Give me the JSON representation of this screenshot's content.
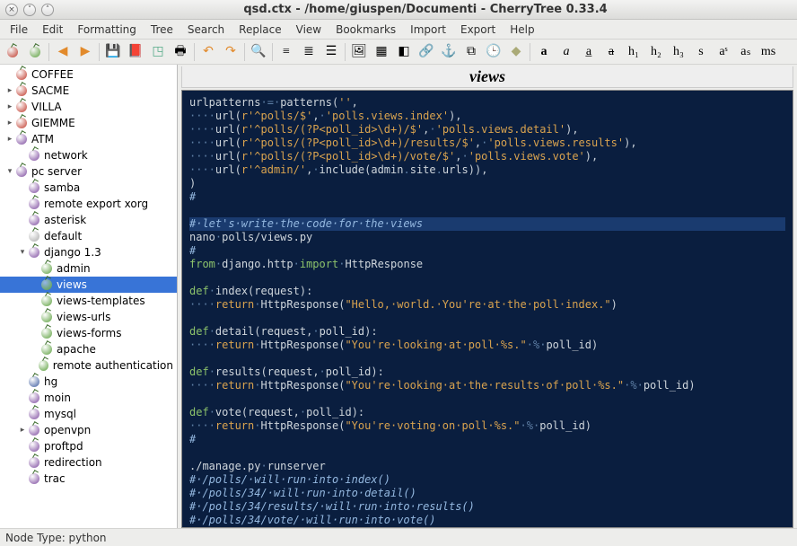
{
  "window": {
    "title": "qsd.ctx - /home/giuspen/Documenti - CherryTree 0.33.4"
  },
  "menubar": [
    "File",
    "Edit",
    "Formatting",
    "Tree",
    "Search",
    "Replace",
    "View",
    "Bookmarks",
    "Import",
    "Export",
    "Help"
  ],
  "toolbar_groups": [
    [
      {
        "name": "cherry-red-icon",
        "glyph": "",
        "cls": "cherry c-red"
      },
      {
        "name": "cherry-green-icon",
        "glyph": "",
        "cls": "cherry c-green"
      }
    ],
    [
      {
        "name": "back-icon",
        "glyph": "◀",
        "color": "#e28a2b"
      },
      {
        "name": "forward-icon",
        "glyph": "▶",
        "color": "#e28a2b"
      }
    ],
    [
      {
        "name": "save-icon",
        "glyph": "💾"
      },
      {
        "name": "export-pdf-icon",
        "glyph": "📕"
      },
      {
        "name": "find-replace-icon",
        "glyph": "◳",
        "color": "#5a8"
      },
      {
        "name": "print-icon",
        "glyph": "🖶"
      }
    ],
    [
      {
        "name": "undo-icon",
        "glyph": "↶",
        "color": "#e28a2b"
      },
      {
        "name": "redo-icon",
        "glyph": "↷",
        "color": "#e28a2b"
      }
    ],
    [
      {
        "name": "search-icon",
        "glyph": "🔍"
      }
    ],
    [
      {
        "name": "bullet-list-icon",
        "glyph": "≡"
      },
      {
        "name": "numbered-list-icon",
        "glyph": "≣"
      },
      {
        "name": "todo-list-icon",
        "glyph": "☰"
      }
    ],
    [
      {
        "name": "insert-image-icon",
        "glyph": "🖼"
      },
      {
        "name": "insert-table-icon",
        "glyph": "▦"
      },
      {
        "name": "insert-codebox-icon",
        "glyph": "◧"
      },
      {
        "name": "insert-link-icon",
        "glyph": "🔗"
      },
      {
        "name": "insert-anchor-icon",
        "glyph": "⚓"
      },
      {
        "name": "insert-toc-icon",
        "glyph": "⧉"
      },
      {
        "name": "insert-timestamp-icon",
        "glyph": "🕒"
      },
      {
        "name": "insert-special-icon",
        "glyph": "◆",
        "color": "#aa7"
      }
    ],
    [
      {
        "name": "format-bold-icon",
        "glyph": "a",
        "bold": true
      },
      {
        "name": "format-italic-icon",
        "glyph": "a",
        "italic": true
      },
      {
        "name": "format-underline-icon",
        "glyph": "a̲"
      },
      {
        "name": "format-strike-icon",
        "glyph": "a",
        "strike": true
      },
      {
        "name": "format-h1-icon",
        "glyph": "h₁"
      },
      {
        "name": "format-h2-icon",
        "glyph": "h₂"
      },
      {
        "name": "format-h3-icon",
        "glyph": "h₃"
      },
      {
        "name": "format-small-icon",
        "glyph": "s"
      },
      {
        "name": "format-sup-icon",
        "glyph": "aˢ"
      },
      {
        "name": "format-sub-icon",
        "glyph": "aₛ"
      },
      {
        "name": "format-mono-icon",
        "glyph": "ms"
      }
    ]
  ],
  "tree": [
    {
      "label": "COFFEE",
      "depth": 0,
      "exp": "",
      "color": "c-red"
    },
    {
      "label": "SACME",
      "depth": 0,
      "exp": "▸",
      "color": "c-red"
    },
    {
      "label": "VILLA",
      "depth": 0,
      "exp": "▸",
      "color": "c-red"
    },
    {
      "label": "GIEMME",
      "depth": 0,
      "exp": "▸",
      "color": "c-red"
    },
    {
      "label": "ATM",
      "depth": 0,
      "exp": "▸",
      "color": "c-purple"
    },
    {
      "label": "network",
      "depth": 1,
      "exp": "",
      "color": "c-purple"
    },
    {
      "label": "pc server",
      "depth": 0,
      "exp": "▾",
      "color": "c-purple"
    },
    {
      "label": "samba",
      "depth": 1,
      "exp": "",
      "color": "c-purple"
    },
    {
      "label": "remote export xorg",
      "depth": 1,
      "exp": "",
      "color": "c-purple"
    },
    {
      "label": "asterisk",
      "depth": 1,
      "exp": "",
      "color": "c-purple"
    },
    {
      "label": "default",
      "depth": 1,
      "exp": "",
      "color": "c-gray"
    },
    {
      "label": "django 1.3",
      "depth": 1,
      "exp": "▾",
      "color": "c-purple"
    },
    {
      "label": "admin",
      "depth": 2,
      "exp": "",
      "color": "c-green"
    },
    {
      "label": "views",
      "depth": 2,
      "exp": "",
      "color": "c-green",
      "selected": true
    },
    {
      "label": "views-templates",
      "depth": 2,
      "exp": "",
      "color": "c-green"
    },
    {
      "label": "views-urls",
      "depth": 2,
      "exp": "",
      "color": "c-green"
    },
    {
      "label": "views-forms",
      "depth": 2,
      "exp": "",
      "color": "c-green"
    },
    {
      "label": "apache",
      "depth": 2,
      "exp": "",
      "color": "c-green"
    },
    {
      "label": "remote authentication",
      "depth": 2,
      "exp": "",
      "color": "c-green"
    },
    {
      "label": "hg",
      "depth": 1,
      "exp": "",
      "color": "c-blue"
    },
    {
      "label": "moin",
      "depth": 1,
      "exp": "",
      "color": "c-purple"
    },
    {
      "label": "mysql",
      "depth": 1,
      "exp": "",
      "color": "c-purple"
    },
    {
      "label": "openvpn",
      "depth": 1,
      "exp": "▸",
      "color": "c-purple"
    },
    {
      "label": "proftpd",
      "depth": 1,
      "exp": "",
      "color": "c-purple"
    },
    {
      "label": "redirection",
      "depth": 1,
      "exp": "",
      "color": "c-purple"
    },
    {
      "label": "trac",
      "depth": 1,
      "exp": "",
      "color": "c-purple"
    }
  ],
  "doc_title": "views",
  "code_lines": [
    [
      {
        "t": "urlpatterns",
        "c": "id"
      },
      {
        "t": "·",
        "c": "samp"
      },
      {
        "t": "=",
        "c": "op"
      },
      {
        "t": "·",
        "c": "samp"
      },
      {
        "t": "patterns",
        "c": "id"
      },
      {
        "t": "(",
        "c": "br"
      },
      {
        "t": "''",
        "c": "str"
      },
      {
        "t": ",",
        "c": "br"
      }
    ],
    [
      {
        "t": "····",
        "c": "samp"
      },
      {
        "t": "url",
        "c": "id"
      },
      {
        "t": "(",
        "c": "br"
      },
      {
        "t": "r'^polls/$'",
        "c": "str"
      },
      {
        "t": ",",
        "c": "br"
      },
      {
        "t": "·",
        "c": "samp"
      },
      {
        "t": "'polls.views.index'",
        "c": "str"
      },
      {
        "t": ")",
        "c": "br"
      },
      {
        "t": ",",
        "c": "br"
      }
    ],
    [
      {
        "t": "····",
        "c": "samp"
      },
      {
        "t": "url",
        "c": "id"
      },
      {
        "t": "(",
        "c": "br"
      },
      {
        "t": "r'^polls/(?P<poll_id>\\d+)/$'",
        "c": "str"
      },
      {
        "t": ",",
        "c": "br"
      },
      {
        "t": "·",
        "c": "samp"
      },
      {
        "t": "'polls.views.detail'",
        "c": "str"
      },
      {
        "t": ")",
        "c": "br"
      },
      {
        "t": ",",
        "c": "br"
      }
    ],
    [
      {
        "t": "····",
        "c": "samp"
      },
      {
        "t": "url",
        "c": "id"
      },
      {
        "t": "(",
        "c": "br"
      },
      {
        "t": "r'^polls/(?P<poll_id>\\d+)/results/$'",
        "c": "str"
      },
      {
        "t": ",",
        "c": "br"
      },
      {
        "t": "·",
        "c": "samp"
      },
      {
        "t": "'polls.views.results'",
        "c": "str"
      },
      {
        "t": ")",
        "c": "br"
      },
      {
        "t": ",",
        "c": "br"
      }
    ],
    [
      {
        "t": "····",
        "c": "samp"
      },
      {
        "t": "url",
        "c": "id"
      },
      {
        "t": "(",
        "c": "br"
      },
      {
        "t": "r'^polls/(?P<poll_id>\\d+)/vote/$'",
        "c": "str"
      },
      {
        "t": ",",
        "c": "br"
      },
      {
        "t": "·",
        "c": "samp"
      },
      {
        "t": "'polls.views.vote'",
        "c": "str"
      },
      {
        "t": ")",
        "c": "br"
      },
      {
        "t": ",",
        "c": "br"
      }
    ],
    [
      {
        "t": "····",
        "c": "samp"
      },
      {
        "t": "url",
        "c": "id"
      },
      {
        "t": "(",
        "c": "br"
      },
      {
        "t": "r'^admin/'",
        "c": "str"
      },
      {
        "t": ",",
        "c": "br"
      },
      {
        "t": "·",
        "c": "samp"
      },
      {
        "t": "include",
        "c": "id"
      },
      {
        "t": "(",
        "c": "br"
      },
      {
        "t": "admin",
        "c": "id"
      },
      {
        "t": ".",
        "c": "op"
      },
      {
        "t": "site",
        "c": "id"
      },
      {
        "t": ".",
        "c": "op"
      },
      {
        "t": "urls",
        "c": "id"
      },
      {
        "t": "))",
        "c": "br"
      },
      {
        "t": ",",
        "c": "br"
      }
    ],
    [
      {
        "t": ")",
        "c": "br"
      }
    ],
    [
      {
        "t": "#",
        "c": "cmt"
      }
    ],
    [
      {
        "t": "",
        "c": "id"
      }
    ],
    [
      {
        "t": "#·let's·write·the·code·for·the·views",
        "c": "cmt",
        "hl": true
      }
    ],
    [
      {
        "t": "nano",
        "c": "id"
      },
      {
        "t": "·",
        "c": "samp"
      },
      {
        "t": "polls/views.py",
        "c": "id"
      }
    ],
    [
      {
        "t": "#",
        "c": "cmt"
      }
    ],
    [
      {
        "t": "from",
        "c": "kw"
      },
      {
        "t": "·",
        "c": "samp"
      },
      {
        "t": "django.http",
        "c": "id"
      },
      {
        "t": "·",
        "c": "samp"
      },
      {
        "t": "import",
        "c": "kw"
      },
      {
        "t": "·",
        "c": "samp"
      },
      {
        "t": "HttpResponse",
        "c": "id"
      }
    ],
    [
      {
        "t": "",
        "c": "id"
      }
    ],
    [
      {
        "t": "def",
        "c": "kw"
      },
      {
        "t": "·",
        "c": "samp"
      },
      {
        "t": "index",
        "c": "id"
      },
      {
        "t": "(",
        "c": "br"
      },
      {
        "t": "request",
        "c": "id"
      },
      {
        "t": "):",
        "c": "br"
      }
    ],
    [
      {
        "t": "····",
        "c": "samp"
      },
      {
        "t": "return",
        "c": "str"
      },
      {
        "t": "·",
        "c": "samp"
      },
      {
        "t": "HttpResponse",
        "c": "id"
      },
      {
        "t": "(",
        "c": "br"
      },
      {
        "t": "\"Hello,·world.·You're·at·the·poll·index.\"",
        "c": "str"
      },
      {
        "t": ")",
        "c": "br"
      }
    ],
    [
      {
        "t": "",
        "c": "id"
      }
    ],
    [
      {
        "t": "def",
        "c": "kw"
      },
      {
        "t": "·",
        "c": "samp"
      },
      {
        "t": "detail",
        "c": "id"
      },
      {
        "t": "(",
        "c": "br"
      },
      {
        "t": "request",
        "c": "id"
      },
      {
        "t": ",",
        "c": "br"
      },
      {
        "t": "·",
        "c": "samp"
      },
      {
        "t": "poll_id",
        "c": "id"
      },
      {
        "t": "):",
        "c": "br"
      }
    ],
    [
      {
        "t": "····",
        "c": "samp"
      },
      {
        "t": "return",
        "c": "str"
      },
      {
        "t": "·",
        "c": "samp"
      },
      {
        "t": "HttpResponse",
        "c": "id"
      },
      {
        "t": "(",
        "c": "br"
      },
      {
        "t": "\"You're·looking·at·poll·%s.\"",
        "c": "str"
      },
      {
        "t": "·",
        "c": "samp"
      },
      {
        "t": "%",
        "c": "op"
      },
      {
        "t": "·",
        "c": "samp"
      },
      {
        "t": "poll_id",
        "c": "id"
      },
      {
        "t": ")",
        "c": "br"
      }
    ],
    [
      {
        "t": "",
        "c": "id"
      }
    ],
    [
      {
        "t": "def",
        "c": "kw"
      },
      {
        "t": "·",
        "c": "samp"
      },
      {
        "t": "results",
        "c": "id"
      },
      {
        "t": "(",
        "c": "br"
      },
      {
        "t": "request",
        "c": "id"
      },
      {
        "t": ",",
        "c": "br"
      },
      {
        "t": "·",
        "c": "samp"
      },
      {
        "t": "poll_id",
        "c": "id"
      },
      {
        "t": "):",
        "c": "br"
      }
    ],
    [
      {
        "t": "····",
        "c": "samp"
      },
      {
        "t": "return",
        "c": "str"
      },
      {
        "t": "·",
        "c": "samp"
      },
      {
        "t": "HttpResponse",
        "c": "id"
      },
      {
        "t": "(",
        "c": "br"
      },
      {
        "t": "\"You're·looking·at·the·results·of·poll·%s.\"",
        "c": "str"
      },
      {
        "t": "·",
        "c": "samp"
      },
      {
        "t": "%",
        "c": "op"
      },
      {
        "t": "·",
        "c": "samp"
      },
      {
        "t": "poll_id",
        "c": "id"
      },
      {
        "t": ")",
        "c": "br"
      }
    ],
    [
      {
        "t": "",
        "c": "id"
      }
    ],
    [
      {
        "t": "def",
        "c": "kw"
      },
      {
        "t": "·",
        "c": "samp"
      },
      {
        "t": "vote",
        "c": "id"
      },
      {
        "t": "(",
        "c": "br"
      },
      {
        "t": "request",
        "c": "id"
      },
      {
        "t": ",",
        "c": "br"
      },
      {
        "t": "·",
        "c": "samp"
      },
      {
        "t": "poll_id",
        "c": "id"
      },
      {
        "t": "):",
        "c": "br"
      }
    ],
    [
      {
        "t": "····",
        "c": "samp"
      },
      {
        "t": "return",
        "c": "str"
      },
      {
        "t": "·",
        "c": "samp"
      },
      {
        "t": "HttpResponse",
        "c": "id"
      },
      {
        "t": "(",
        "c": "br"
      },
      {
        "t": "\"You're·voting·on·poll·%s.\"",
        "c": "str"
      },
      {
        "t": "·",
        "c": "samp"
      },
      {
        "t": "%",
        "c": "op"
      },
      {
        "t": "·",
        "c": "samp"
      },
      {
        "t": "poll_id",
        "c": "id"
      },
      {
        "t": ")",
        "c": "br"
      }
    ],
    [
      {
        "t": "#",
        "c": "cmt"
      }
    ],
    [
      {
        "t": "",
        "c": "id"
      }
    ],
    [
      {
        "t": "./manage.py",
        "c": "id"
      },
      {
        "t": "·",
        "c": "samp"
      },
      {
        "t": "runserver",
        "c": "id"
      }
    ],
    [
      {
        "t": "#·/polls/·will·run·into·index()",
        "c": "cmt"
      }
    ],
    [
      {
        "t": "#·/polls/34/·will·run·into·detail()",
        "c": "cmt"
      }
    ],
    [
      {
        "t": "#·/polls/34/results/·will·run·into·results()",
        "c": "cmt"
      }
    ],
    [
      {
        "t": "#·/polls/34/vote/·will·run·into·vote()",
        "c": "cmt"
      }
    ]
  ],
  "statusbar": {
    "node_type": "Node Type: python"
  }
}
